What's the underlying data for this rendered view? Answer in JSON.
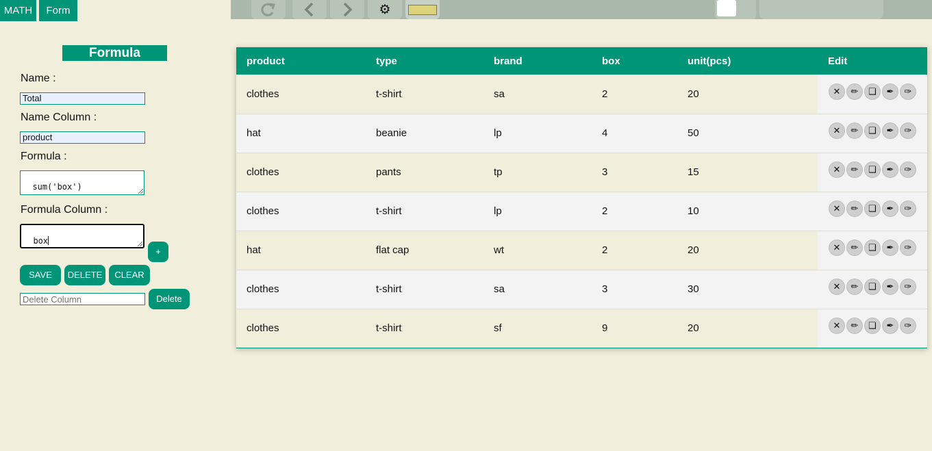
{
  "tabs": {
    "math": "MATH",
    "form": "Form"
  },
  "toolbar": {
    "refresh_icon": "refresh-icon",
    "prev_icon": "chevron-left-icon",
    "next_icon": "chevron-right-icon",
    "gear_glyph": "⚙",
    "swatch_color": "#dcd37a"
  },
  "form": {
    "title": "Formula",
    "name_label": "Name :",
    "name_value": "Total",
    "name_column_label": "Name Column :",
    "name_column_value": "product",
    "formula_label": "Formula :",
    "formula_value": "sum('box')",
    "formula_column_label": "Formula Column :",
    "formula_column_value": "box",
    "add_label": "+",
    "save_label": "SAVE",
    "delete_label": "DELETE",
    "clear_label": "CLEAR",
    "delete_column_placeholder": "Delete Column",
    "delete_column_button": "Delete"
  },
  "table": {
    "headers": [
      "product",
      "type",
      "brand",
      "box",
      "unit(pcs)",
      "Edit"
    ],
    "rows": [
      [
        "clothes",
        "t-shirt",
        "sa",
        "2",
        "20"
      ],
      [
        "hat",
        "beanie",
        "lp",
        "4",
        "50"
      ],
      [
        "clothes",
        "pants",
        "tp",
        "3",
        "15"
      ],
      [
        "clothes",
        "t-shirt",
        "lp",
        "2",
        "10"
      ],
      [
        "hat",
        "flat cap",
        "wt",
        "2",
        "20"
      ],
      [
        "clothes",
        "t-shirt",
        "sa",
        "3",
        "30"
      ],
      [
        "clothes",
        "t-shirt",
        "sf",
        "9",
        "20"
      ]
    ],
    "edit_icons": [
      "✕",
      "✏",
      "❑",
      "✒",
      "✑"
    ],
    "edit_icon_names": [
      "close-icon",
      "pencil-icon",
      "copy-icon",
      "pen-nib-icon",
      "pen-outline-icon"
    ]
  }
}
